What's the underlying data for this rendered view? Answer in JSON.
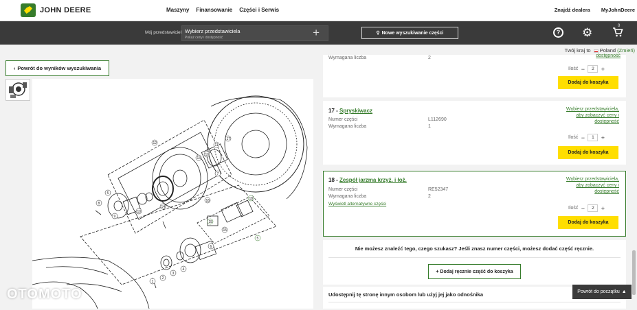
{
  "header": {
    "brand": "JOHN DEERE",
    "nav": [
      "Maszyny",
      "Finansowanie",
      "Części i Serwis"
    ],
    "right_links": [
      "Znajdź dealera",
      "MyJohnDeere"
    ]
  },
  "dealer_bar": {
    "label": "Mój przedstawiciel",
    "title": "Wybierz przedstawiciela",
    "subtitle": "Pokaż ceny i dostępność",
    "search_label": "Nowe wyszukiwanie części",
    "cart_count": "0"
  },
  "country": {
    "prefix": "Twój kraj to",
    "name": "Poland",
    "change": "(Zmień)"
  },
  "back_button": "Powrót do wyników wyszukiwania",
  "labels": {
    "part_number": "Numer części",
    "required_qty": "Wymagana liczba",
    "quantity": "Ilość",
    "add_to_cart": "Dodaj do koszyka",
    "select_dealer": "Wybierz przedstawiciela, aby zobaczyć ceny i dostępność"
  },
  "top_partial": {
    "required_qty": "2",
    "quantity": "2"
  },
  "parts": [
    {
      "num": "17",
      "name": "Spryskiwacz",
      "part_number": "L112690",
      "required_qty": "1",
      "quantity": "1"
    },
    {
      "num": "18",
      "name": "Zespół jarzma krzyż. i łoż.",
      "part_number": "RE52347",
      "required_qty": "2",
      "quantity": "2",
      "alt_link": "Wyświetl alternatywne części"
    }
  ],
  "not_found": {
    "text": "Nie możesz znaleźć tego, czego szukasz? Jeśli znasz numer części, możesz dodać część ręcznie.",
    "button": "+ Dodaj ręcznie część do koszyka"
  },
  "share_text": "Udostępnij tę stronę innym osobom lub użyj jej jako odnośnika",
  "back_to_top": "Powrót do początku",
  "watermark": "OTOMOTO",
  "diagram_callouts": [
    "12",
    "17",
    "11",
    "10",
    "13",
    "7",
    "16",
    "5",
    "8",
    "9",
    "10",
    "14",
    "18",
    "15",
    "5",
    "6",
    "15",
    "4",
    "3",
    "2",
    "1",
    "18",
    "20"
  ],
  "colors": {
    "brand_green": "#367c2b",
    "brand_yellow": "#ffde00",
    "dark_bar": "#3a3a3a"
  }
}
